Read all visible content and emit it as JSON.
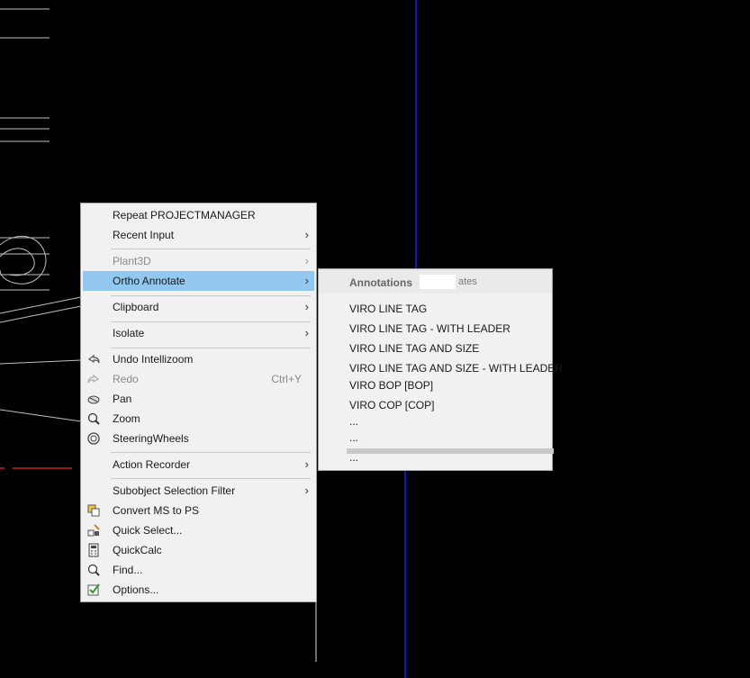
{
  "context_menu": {
    "items": [
      {
        "label": "Repeat PROJECTMANAGER"
      },
      {
        "label": "Recent Input",
        "submenu": true
      },
      {
        "label": "Plant3D",
        "submenu": true,
        "disabled": true
      },
      {
        "label": "Ortho Annotate",
        "submenu": true,
        "active": true
      },
      {
        "label": "Clipboard",
        "submenu": true
      },
      {
        "label": "Isolate",
        "submenu": true
      },
      {
        "label": "Undo Intellizoom",
        "icon": "undo-icon"
      },
      {
        "label": "Redo",
        "shortcut": "Ctrl+Y",
        "disabled": true,
        "icon": "redo-icon"
      },
      {
        "label": "Pan",
        "icon": "pan-hand-icon"
      },
      {
        "label": "Zoom",
        "icon": "zoom-icon"
      },
      {
        "label": "SteeringWheels",
        "icon": "steering-wheel-icon"
      },
      {
        "label": "Action Recorder",
        "submenu": true
      },
      {
        "label": "Subobject Selection Filter",
        "submenu": true
      },
      {
        "label": "Convert MS to PS",
        "icon": "convert-icon"
      },
      {
        "label": "Quick Select...",
        "icon": "quick-select-icon"
      },
      {
        "label": "QuickCalc",
        "icon": "calculator-icon"
      },
      {
        "label": "Find...",
        "icon": "find-icon"
      },
      {
        "label": "Options...",
        "icon": "options-check-icon"
      }
    ]
  },
  "submenu": {
    "header": "Annotations",
    "header_suffix": "ates",
    "items": [
      "VIRO LINE TAG",
      "VIRO LINE TAG - WITH LEADER",
      "VIRO LINE TAG AND SIZE",
      "VIRO LINE TAG AND SIZE - WITH LEADER",
      "VIRO BOP [BOP]",
      "VIRO COP [COP]",
      "...",
      "...",
      "..."
    ]
  },
  "arrow_glyph": "›",
  "colors": {
    "active": "#92c8f0",
    "axis_blue": "#1a1aff",
    "axis_red": "#cc1f1f"
  }
}
